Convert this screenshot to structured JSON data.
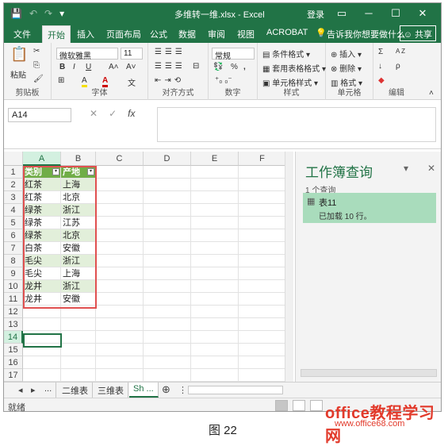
{
  "window": {
    "title": "多维转一维.xlsx - Excel",
    "login": "登录",
    "qat": {
      "save": "💾",
      "undo": "↶",
      "redo": "↷",
      "customize": "▾"
    },
    "controls": {
      "ribbon_display": "▭",
      "minimize": "─",
      "maximize": "☐",
      "close": "✕"
    }
  },
  "tabs": [
    {
      "label": "文件"
    },
    {
      "label": "开始"
    },
    {
      "label": "插入"
    },
    {
      "label": "页面布局"
    },
    {
      "label": "公式"
    },
    {
      "label": "数据"
    },
    {
      "label": "审阅"
    },
    {
      "label": "视图"
    },
    {
      "label": "ACROBAT"
    },
    {
      "label": "告诉我你想要做什么"
    }
  ],
  "tell_me_icon": "💡",
  "share": "共享",
  "ribbon": {
    "clipboard": {
      "label": "剪贴板",
      "paste": "粘贴"
    },
    "font": {
      "label": "字体",
      "font_name": "微软雅黑",
      "font_size": "11",
      "bold": "B",
      "italic": "I",
      "underline": "U",
      "grow": "A˄",
      "shrink": "A˅",
      "fill": "A",
      "color": "A",
      "wen": "文"
    },
    "alignment": {
      "label": "对齐方式"
    },
    "number": {
      "label": "数字",
      "format": "常规",
      "percent": "%",
      "comma": ","
    },
    "styles": {
      "label": "样式",
      "conditional": "条件格式",
      "table": "套用表格格式",
      "cell_styles": "单元格样式"
    },
    "cells": {
      "label": "单元格",
      "insert": "插入",
      "delete": "删除",
      "format": "格式"
    },
    "editing": {
      "label": "编辑",
      "sum": "Σ",
      "sort": "A Z",
      "fill": "↓",
      "find": "ρ",
      "clear": "◆"
    }
  },
  "formula_bar": {
    "name_box": "A14",
    "cancel": "✕",
    "enter": "✓",
    "fx": "fx",
    "value": ""
  },
  "columns": [
    "A",
    "B",
    "C",
    "D",
    "E",
    "F"
  ],
  "rows": [
    "1",
    "2",
    "3",
    "4",
    "5",
    "6",
    "7",
    "8",
    "9",
    "10",
    "11",
    "12",
    "13",
    "14",
    "15",
    "16",
    "17"
  ],
  "table": {
    "headers": [
      "类别",
      "产地"
    ],
    "body": [
      [
        "红茶",
        "上海"
      ],
      [
        "红茶",
        "北京"
      ],
      [
        "绿茶",
        "浙江"
      ],
      [
        "绿茶",
        "江苏"
      ],
      [
        "绿茶",
        "北京"
      ],
      [
        "白茶",
        "安徽"
      ],
      [
        "毛尖",
        "浙江"
      ],
      [
        "毛尖",
        "上海"
      ],
      [
        "龙井",
        "浙江"
      ],
      [
        "龙井",
        "安徽"
      ]
    ]
  },
  "active_cell": "A14",
  "query_pane": {
    "title": "工作簿查询",
    "count": "1 个查询",
    "items": [
      {
        "name": "表11",
        "status": "已加载 10 行。"
      }
    ]
  },
  "sheets": [
    {
      "label": "..."
    },
    {
      "label": "二维表"
    },
    {
      "label": "三维表"
    },
    {
      "label": "Sh ..."
    }
  ],
  "status": "就绪",
  "watermark": {
    "line1": "office教程学习网",
    "line2": "www.office68.com"
  },
  "caption": "图 22",
  "colors": {
    "accent": "#217346",
    "table_header": "#70ad47",
    "table_band": "#e2efda",
    "query_item": "#a9dcbc",
    "selection": "#e05050"
  }
}
